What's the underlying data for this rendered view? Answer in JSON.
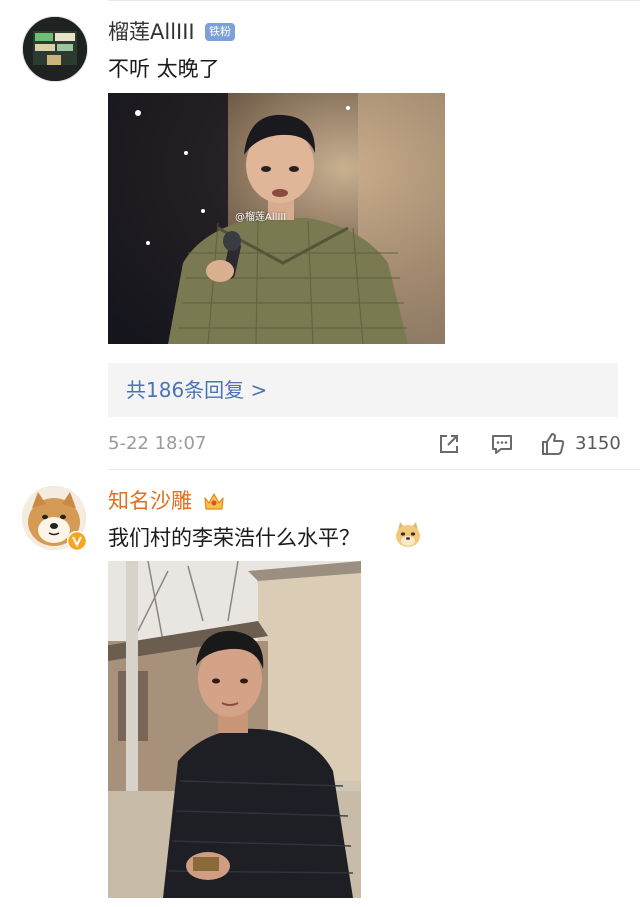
{
  "comment1": {
    "username": "榴莲AllIII",
    "fan_badge": "铁粉",
    "text": "不听 太晚了",
    "image_watermark": "@榴莲AllIII",
    "replies_label": "共186条回复 >",
    "time": "5-22 18:07",
    "like_count": "3150"
  },
  "comment2": {
    "username": "知名沙雕",
    "text": "我们村的李荣浩什么水平？",
    "emoji": "doge"
  },
  "colors": {
    "link_blue": "#4a74b5",
    "vip_orange": "#e46d1e",
    "meta_gray": "#9b9b9b",
    "reply_bg": "#f4f4f4",
    "fan_badge": "#7da1d6"
  },
  "icons": [
    "share-icon",
    "comment-icon",
    "like-icon",
    "crown-icon",
    "verified-badge-icon",
    "doge-emoji"
  ]
}
